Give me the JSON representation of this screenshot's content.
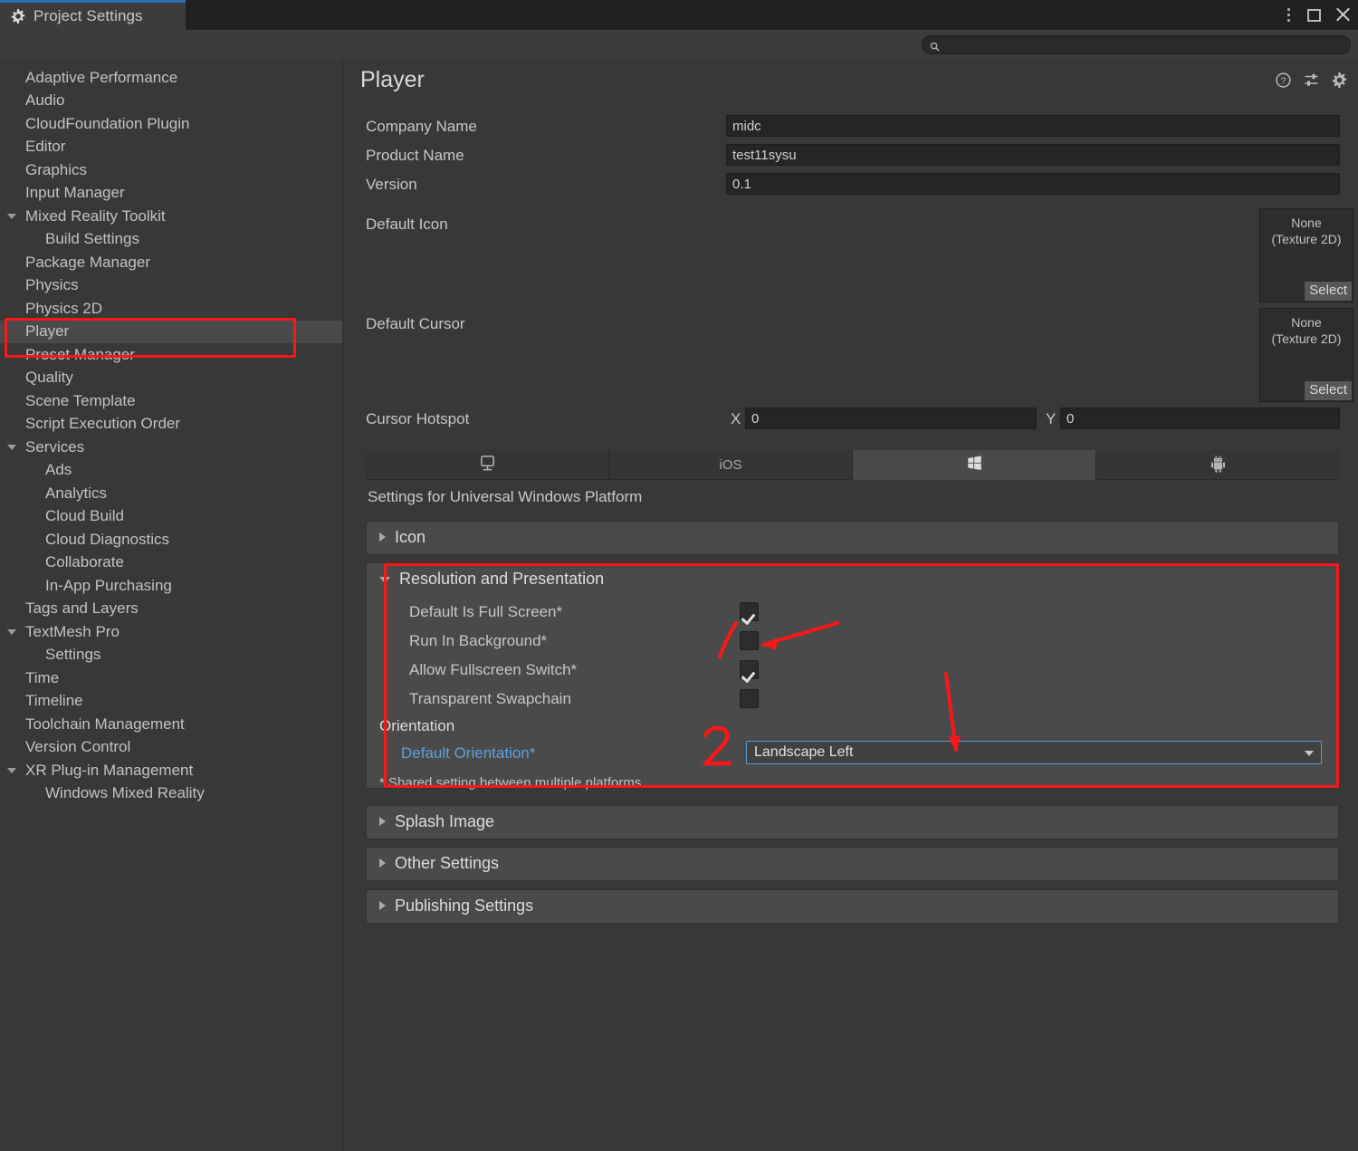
{
  "window": {
    "tab_title": "Project Settings",
    "tab_icon": "gear-icon",
    "controls": {
      "menu": "kebab-menu-icon",
      "maximize": "maximize-icon",
      "close": "close-icon"
    }
  },
  "search": {
    "value": "",
    "placeholder": "",
    "icon": "search-icon"
  },
  "sidebar": {
    "items": [
      {
        "label": "Adaptive Performance",
        "level": 0,
        "arrow": "none"
      },
      {
        "label": "Audio",
        "level": 0,
        "arrow": "none"
      },
      {
        "label": "CloudFoundation Plugin",
        "level": 0,
        "arrow": "none"
      },
      {
        "label": "Editor",
        "level": 0,
        "arrow": "none"
      },
      {
        "label": "Graphics",
        "level": 0,
        "arrow": "none"
      },
      {
        "label": "Input Manager",
        "level": 0,
        "arrow": "none"
      },
      {
        "label": "Mixed Reality Toolkit",
        "level": 0,
        "arrow": "open"
      },
      {
        "label": "Build Settings",
        "level": 1,
        "arrow": "none"
      },
      {
        "label": "Package Manager",
        "level": 0,
        "arrow": "none"
      },
      {
        "label": "Physics",
        "level": 0,
        "arrow": "none"
      },
      {
        "label": "Physics 2D",
        "level": 0,
        "arrow": "none"
      },
      {
        "label": "Player",
        "level": 0,
        "arrow": "none",
        "selected": true
      },
      {
        "label": "Preset Manager",
        "level": 0,
        "arrow": "none"
      },
      {
        "label": "Quality",
        "level": 0,
        "arrow": "none"
      },
      {
        "label": "Scene Template",
        "level": 0,
        "arrow": "none"
      },
      {
        "label": "Script Execution Order",
        "level": 0,
        "arrow": "none"
      },
      {
        "label": "Services",
        "level": 0,
        "arrow": "open"
      },
      {
        "label": "Ads",
        "level": 1,
        "arrow": "none"
      },
      {
        "label": "Analytics",
        "level": 1,
        "arrow": "none"
      },
      {
        "label": "Cloud Build",
        "level": 1,
        "arrow": "none"
      },
      {
        "label": "Cloud Diagnostics",
        "level": 1,
        "arrow": "none"
      },
      {
        "label": "Collaborate",
        "level": 1,
        "arrow": "none"
      },
      {
        "label": "In-App Purchasing",
        "level": 1,
        "arrow": "none"
      },
      {
        "label": "Tags and Layers",
        "level": 0,
        "arrow": "none"
      },
      {
        "label": "TextMesh Pro",
        "level": 0,
        "arrow": "open"
      },
      {
        "label": "Settings",
        "level": 1,
        "arrow": "none"
      },
      {
        "label": "Time",
        "level": 0,
        "arrow": "none"
      },
      {
        "label": "Timeline",
        "level": 0,
        "arrow": "none"
      },
      {
        "label": "Toolchain Management",
        "level": 0,
        "arrow": "none"
      },
      {
        "label": "Version Control",
        "level": 0,
        "arrow": "none"
      },
      {
        "label": "XR Plug-in Management",
        "level": 0,
        "arrow": "open"
      },
      {
        "label": "Windows Mixed Reality",
        "level": 1,
        "arrow": "none"
      }
    ]
  },
  "main": {
    "title": "Player",
    "header_icons": [
      "help-icon",
      "preset-icon",
      "gear-icon"
    ],
    "fields": {
      "company_name_label": "Company Name",
      "company_name_value": "midc",
      "product_name_label": "Product Name",
      "product_name_value": "test11sysu",
      "version_label": "Version",
      "version_value": "0.1",
      "default_icon_label": "Default Icon",
      "default_cursor_label": "Default Cursor",
      "object_none": "None",
      "object_type": "(Texture 2D)",
      "select_button": "Select",
      "cursor_hotspot_label": "Cursor Hotspot",
      "x_label": "X",
      "x_value": "0",
      "y_label": "Y",
      "y_value": "0"
    },
    "platform_tabs": [
      {
        "label": "",
        "icon": "monitor-icon",
        "active": false
      },
      {
        "label": "iOS",
        "icon": "",
        "active": false
      },
      {
        "label": "",
        "icon": "windows-icon",
        "active": true
      },
      {
        "label": "",
        "icon": "android-icon",
        "active": false
      }
    ],
    "settings_for": "Settings for Universal Windows Platform",
    "sections": [
      {
        "title": "Icon",
        "expanded": false
      },
      {
        "title": "Resolution and Presentation",
        "expanded": true
      },
      {
        "title": "Splash Image",
        "expanded": false
      },
      {
        "title": "Other Settings",
        "expanded": false
      },
      {
        "title": "Publishing Settings",
        "expanded": false
      }
    ],
    "resolution": {
      "checkboxes": [
        {
          "label": "Default Is Full Screen*",
          "checked": true
        },
        {
          "label": "Run In Background*",
          "checked": false
        },
        {
          "label": "Allow Fullscreen Switch*",
          "checked": true
        },
        {
          "label": "Transparent Swapchain",
          "checked": false
        }
      ],
      "orientation_group_label": "Orientation",
      "default_orientation_label": "Default Orientation*",
      "default_orientation_value": "Landscape Left",
      "footnote": "* Shared setting between multiple platforms."
    }
  },
  "annotations": {
    "marker_one": "1",
    "marker_two": "2",
    "color": "#fb1717"
  }
}
